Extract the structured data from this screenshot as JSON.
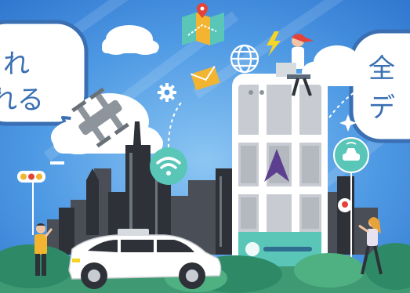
{
  "colors": {
    "sky": "#3e8ce0",
    "sky_light": "#7fbbf0",
    "bubble_stroke": "#3a6fb3",
    "city_dark": "#2e3137",
    "city_mid": "#4a4e56",
    "teal": "#59c6b8",
    "route": "#f4f4f4",
    "ground": "#3f9a73",
    "bush": "#2e8a66",
    "phone_frame": "#ffffff",
    "map_bg": "#c8ccd2",
    "arrow": "#5c3f8f"
  },
  "icons": {
    "map": "folded-map-icon",
    "pin": "location-pin-icon",
    "bolt": "lightning-icon",
    "globe": "globe-icon",
    "mail": "envelope-icon",
    "gear": "gear-icon",
    "wifi": "wifi-icon",
    "car": "car-icon",
    "drone": "drone-icon",
    "traffic_light": "traffic-light-icon"
  },
  "bubbles": {
    "left_line1": "れ",
    "left_line2": "れる",
    "right_line1": "全",
    "right_line2": "デ"
  }
}
